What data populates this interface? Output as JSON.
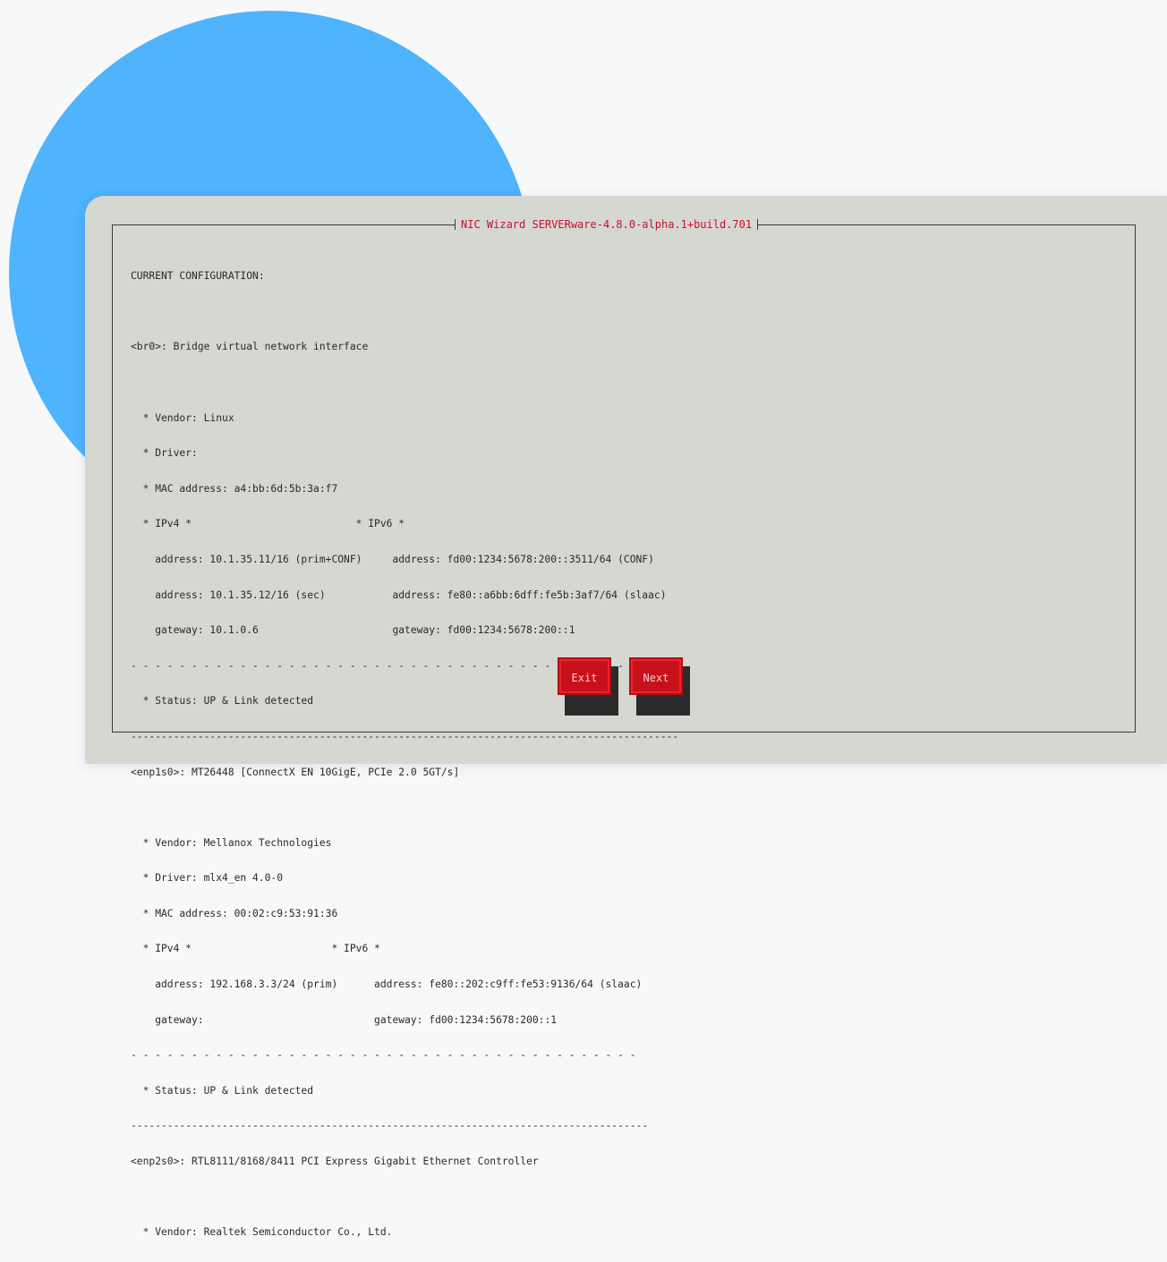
{
  "window": {
    "title": "NIC Wizard SERVERware-4.8.0-alpha.1+build.701"
  },
  "console": {
    "lines": [
      "CURRENT CONFIGURATION:",
      "",
      "<br0>: Bridge virtual network interface",
      "",
      "  * Vendor: Linux",
      "  * Driver:",
      "  * MAC address: a4:bb:6d:5b:3a:f7",
      "  * IPv4 *                           * IPv6 *",
      "    address: 10.1.35.11/16 (prim+CONF)     address: fd00:1234:5678:200::3511/64 (CONF)",
      "    address: 10.1.35.12/16 (sec)           address: fe80::a6bb:6dff:fe5b:3af7/64 (slaac)",
      "    gateway: 10.1.0.6                      gateway: fd00:1234:5678:200::1",
      "- - - - - - - - - - - - - - - - - - - - - - - - - - - - - - - - - - - - - - - - - - - -",
      "  * Status: UP & Link detected",
      "------------------------------------------------------------------------------------------",
      "<enp1s0>: MT26448 [ConnectX EN 10GigE, PCIe 2.0 5GT/s]",
      "",
      "  * Vendor: Mellanox Technologies",
      "  * Driver: mlx4_en 4.0-0",
      "  * MAC address: 00:02:c9:53:91:36",
      "  * IPv4 *                       * IPv6 *",
      "    address: 192.168.3.3/24 (prim)      address: fe80::202:c9ff:fe53:9136/64 (slaac)",
      "    gateway:                            gateway: fd00:1234:5678:200::1",
      "- - - - - - - - - - - - - - - - - - - - - - - - - - - - - - - - - - - - - - - - - -",
      "  * Status: UP & Link detected",
      "-------------------------------------------------------------------------------------",
      "<enp2s0>: RTL8111/8168/8411 PCI Express Gigabit Ethernet Controller",
      "",
      "  * Vendor: Realtek Semiconductor Co., Ltd."
    ]
  },
  "buttons": {
    "exit_label": "Exit",
    "next_label": "Next"
  },
  "colors": {
    "accent": "#c8101a",
    "title_text": "#c8102e",
    "panel_bg": "#d5d7d1",
    "circle": "#4fb3fe"
  }
}
